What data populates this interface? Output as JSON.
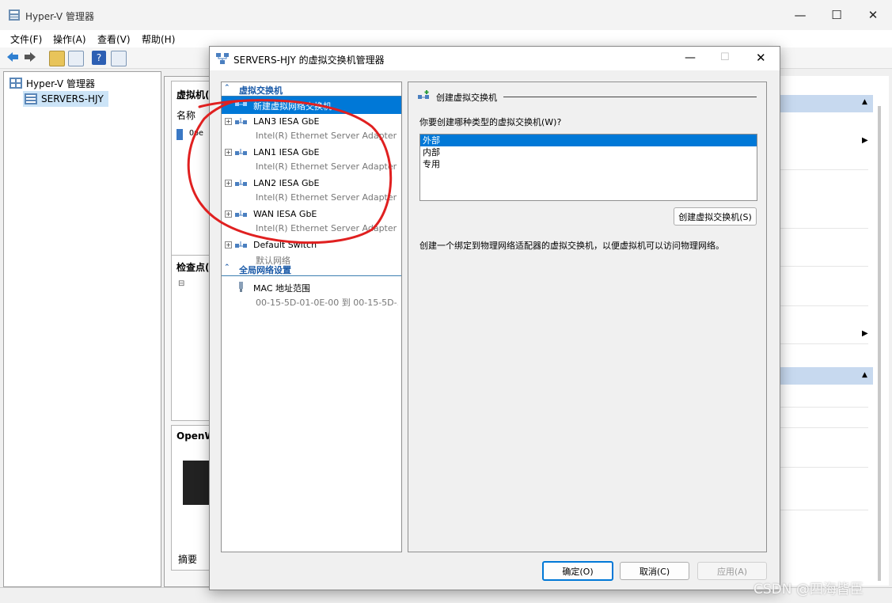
{
  "main_window": {
    "title": "Hyper-V 管理器",
    "menu": [
      "文件(F)",
      "操作(A)",
      "查看(V)",
      "帮助(H)"
    ],
    "tree": {
      "root": "Hyper-V 管理器",
      "server": "SERVERS-HJY"
    },
    "middle": {
      "vm_header": "虚拟机(",
      "name_col": "名称",
      "vm_name": "Ope",
      "checkpoint_header": "检查点(",
      "preview_header": "OpenW",
      "summary_tab": "摘要"
    }
  },
  "dialog": {
    "title": "SERVERS-HJY 的虚拟交换机管理器",
    "sections": {
      "virtual_switches": "虚拟交换机",
      "global_settings": "全局网络设置"
    },
    "switches": [
      {
        "name": "新建虚拟网络交换机",
        "sub": "",
        "selected": true
      },
      {
        "name": "LAN3 IESA GbE",
        "sub": "Intel(R) Ethernet Server Adapter ..."
      },
      {
        "name": "LAN1 IESA GbE",
        "sub": "Intel(R) Ethernet Server Adapter ..."
      },
      {
        "name": "LAN2 IESA GbE",
        "sub": "Intel(R) Ethernet Server Adapter ..."
      },
      {
        "name": "WAN IESA GbE",
        "sub": "Intel(R) Ethernet Server Adapter ..."
      },
      {
        "name": "Default Switch",
        "sub": "默认网络"
      }
    ],
    "mac": {
      "name": "MAC 地址范围",
      "sub": "00-15-5D-01-0E-00 到 00-15-5D-..."
    },
    "right": {
      "header": "创建虚拟交换机",
      "question": "你要创建哪种类型的虚拟交换机(W)?",
      "types": [
        "外部",
        "内部",
        "专用"
      ],
      "selected_type": "外部",
      "create_button": "创建虚拟交换机(S)",
      "description": "创建一个绑定到物理网络适配器的虚拟交换机，以便虚拟机可以访问物理网络。"
    },
    "buttons": {
      "ok": "确定(O)",
      "cancel": "取消(C)",
      "apply": "应用(A)"
    }
  },
  "watermark": "CSDN @四海皆臣",
  "colors": {
    "selection": "#0078d7",
    "section_text": "#1a5aa8",
    "annotation_circle": "#e02020"
  }
}
